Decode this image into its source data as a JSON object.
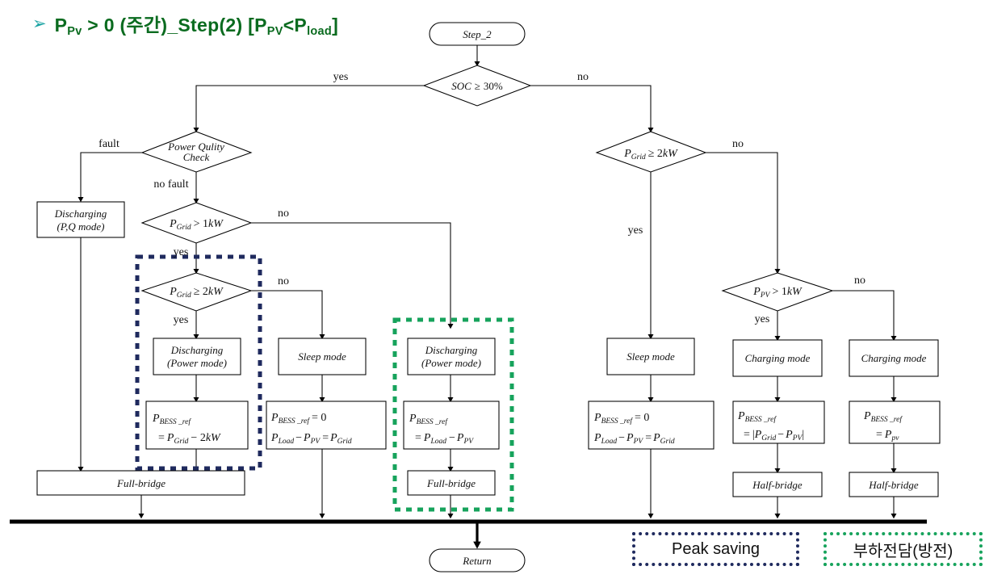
{
  "title": {
    "bullet": "➢",
    "main_prefix": "P",
    "main_sub1": "Pv",
    "main_mid": " > 0  (주간)_Step(2) [P",
    "main_sub2": "PV",
    "main_mid2": "<P",
    "main_sub3": "load",
    "main_suffix": "]",
    "full_text": "P_Pv > 0 (주간)_Step(2) [P_PV<P_load]",
    "color": "#0a6b1f",
    "bullet_color": "#1aa3a3"
  },
  "nodes": {
    "start": "Step_2",
    "soc": "SOC ≥ 30%",
    "pq_check_line1": "Power Qulity",
    "pq_check_line2": "Check",
    "pgrid_gt_1kw": "P_Grid > 1kW",
    "pgrid_ge_2kw_left": "P_Grid ≥ 2kW",
    "pgrid_ge_2kw_right": "P_Grid ≥ 2kW",
    "ppv_gt_1kw": "P_PV > 1kW",
    "discharging_pq_l1": "Discharging",
    "discharging_pq_l2": "(P,Q mode)",
    "discharging_pwr_l1": "Discharging",
    "discharging_pwr_l2": "(Power mode)",
    "discharging_pwr2_l1": "Discharging",
    "discharging_pwr2_l2": "(Power mode)",
    "sleep_mode_left": "Sleep mode",
    "sleep_mode_right": "Sleep mode",
    "charging_mode_1": "Charging mode",
    "charging_mode_2": "Charging mode",
    "full_bridge_left": "Full-bridge",
    "full_bridge_mid": "Full-bridge",
    "half_bridge_1": "Half-bridge",
    "half_bridge_2": "Half-bridge",
    "return": "Return"
  },
  "equations": {
    "eq1_l1": "P_BESS_ref",
    "eq1_l2": "= P_Grid − 2kW",
    "eq2_l1": "P_BESS_ref = 0",
    "eq2_l2": "P_Load − P_PV = P_Grid",
    "eq3_l1": "P_BESS_ref",
    "eq3_l2": "= P_Load − P_PV",
    "eq4_l1": "P_BESS_ref = 0",
    "eq4_l2": "P_Load − P_PV = P_Grid",
    "eq5_l1": "P_BESS_ref",
    "eq5_l2": "= |P_Grid − P_PV|",
    "eq6_l1": "P_BESS_ref",
    "eq6_l2": "= P_pv"
  },
  "edge_labels": {
    "soc_yes": "yes",
    "soc_no": "no",
    "pq_fault": "fault",
    "pq_no_fault": "no fault",
    "pgrid1_no": "no",
    "pgrid1_yes": "yes",
    "pgrid2_no": "no",
    "pgrid2_yes": "yes",
    "pgrid_right_no": "no",
    "pgrid_right_yes": "yes",
    "ppv_no": "no",
    "ppv_yes": "yes"
  },
  "legend": [
    {
      "label": "Peak saving",
      "style": "navy",
      "color": "#1f2a5e"
    },
    {
      "label": "부하전담(방전)",
      "style": "green",
      "color": "#17a35c"
    }
  ],
  "colors": {
    "navy_dash": "#1f2a5e",
    "green_dash": "#17a35c",
    "line": "#000000",
    "title_green": "#0a6b1f"
  }
}
